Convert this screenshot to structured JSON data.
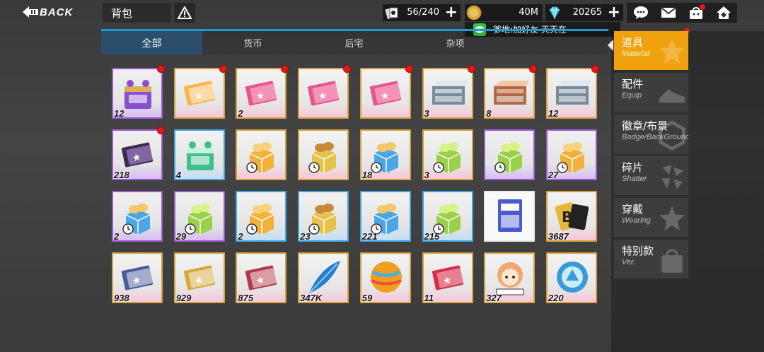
{
  "header": {
    "back_label": "BACK",
    "title": "背包",
    "help_icon": "warning-triangle-icon",
    "resources": [
      {
        "name": "capacity",
        "icon": "cards-icon",
        "value": "56/240",
        "has_plus": true
      },
      {
        "name": "gold",
        "icon": "coin-icon",
        "value": "40M",
        "has_plus": false
      },
      {
        "name": "diamond",
        "icon": "diamond-icon",
        "value": "20265",
        "has_plus": true
      }
    ],
    "plus_label": "+",
    "icons": [
      "chat-bubble-icon",
      "mail-icon",
      "shop-bag-icon",
      "home-icon"
    ]
  },
  "chat": {
    "text": "爹地:加好友 天天在",
    "icon": "wechat-icon",
    "accent": "#2ecc40"
  },
  "tabs": [
    {
      "label": "全部",
      "active": true
    },
    {
      "label": "货币",
      "active": false
    },
    {
      "label": "后宅",
      "active": false
    },
    {
      "label": "杂项",
      "active": false
    }
  ],
  "colors": {
    "accent_blue": "#1e9ad4",
    "tab_active": "#2b4e6b",
    "side_active": "#f0a20e",
    "rarity_gold": "#d2a23b",
    "rarity_purple": "#9c59d1",
    "rarity_blue": "#3fa6e3",
    "badge_red": "#e01a1a"
  },
  "items": [
    {
      "count": "12",
      "rarity": "purple",
      "icon": "purple-gift-box-icon",
      "new": true
    },
    {
      "count": "",
      "rarity": "gold",
      "icon": "orange-ticket-box-icon",
      "new": true
    },
    {
      "count": "2",
      "rarity": "gold",
      "icon": "pink-ticket-icon",
      "new": true
    },
    {
      "count": "",
      "rarity": "gold",
      "icon": "pink-ticket-icon",
      "new": true
    },
    {
      "count": "",
      "rarity": "gold",
      "icon": "pink-ticket-icon",
      "new": true
    },
    {
      "count": "3",
      "rarity": "gold",
      "icon": "grey-card-box-icon",
      "new": true
    },
    {
      "count": "8",
      "rarity": "gold",
      "icon": "brown-card-box-icon",
      "new": true
    },
    {
      "count": "12",
      "rarity": "gold",
      "icon": "grey-card-box-icon",
      "new": true
    },
    {
      "count": "218",
      "rarity": "purple",
      "icon": "black-ticket-icon",
      "new": true
    },
    {
      "count": "4",
      "rarity": "blue",
      "icon": "green-box-icon",
      "new": false
    },
    {
      "count": "",
      "rarity": "gold",
      "icon": "orange-open-box-icon",
      "new": false
    },
    {
      "count": "",
      "rarity": "gold",
      "icon": "yellow-open-box-icon",
      "new": false
    },
    {
      "count": "18",
      "rarity": "gold",
      "icon": "blue-open-box-icon",
      "new": false
    },
    {
      "count": "3",
      "rarity": "gold",
      "icon": "green-open-box-icon",
      "new": false
    },
    {
      "count": "",
      "rarity": "purple",
      "icon": "green-open-box-icon",
      "new": false
    },
    {
      "count": "27",
      "rarity": "purple",
      "icon": "orange-open-box-icon",
      "new": false
    },
    {
      "count": "2",
      "rarity": "purple",
      "icon": "blue-open-box-icon",
      "new": false
    },
    {
      "count": "29",
      "rarity": "purple",
      "icon": "green-open-box-icon",
      "new": false
    },
    {
      "count": "2",
      "rarity": "blue",
      "icon": "orange-open-box-icon",
      "new": false
    },
    {
      "count": "23",
      "rarity": "blue",
      "icon": "yellow-open-box-icon",
      "new": false
    },
    {
      "count": "221",
      "rarity": "blue",
      "icon": "blue-open-box-icon",
      "new": false
    },
    {
      "count": "215",
      "rarity": "blue",
      "icon": "green-open-box-icon",
      "new": false
    },
    {
      "count": "",
      "rarity": "white",
      "icon": "blue-card-icon",
      "new": false
    },
    {
      "count": "3687",
      "rarity": "gold",
      "icon": "bt-token-icon",
      "new": false
    },
    {
      "count": "938",
      "rarity": "gold",
      "icon": "blue-voucher-icon",
      "new": false
    },
    {
      "count": "929",
      "rarity": "gold",
      "icon": "gold-voucher-icon",
      "new": false
    },
    {
      "count": "875",
      "rarity": "gold",
      "icon": "red-voucher-icon",
      "new": false
    },
    {
      "count": "347K",
      "rarity": "gold",
      "icon": "feather-icon",
      "new": false
    },
    {
      "count": "59",
      "rarity": "gold",
      "icon": "striped-ball-icon",
      "new": false
    },
    {
      "count": "11",
      "rarity": "gold",
      "icon": "red-ticket-icon",
      "new": false
    },
    {
      "count": "327",
      "rarity": "gold",
      "icon": "chibi-girl-icon",
      "new": false
    },
    {
      "count": "220",
      "rarity": "gold",
      "icon": "blue-emblem-icon",
      "new": false
    }
  ],
  "sidebar": [
    {
      "cn": "道具",
      "en": "Material",
      "active": true,
      "icon": "star-icon"
    },
    {
      "cn": "配件",
      "en": "Equip",
      "active": false,
      "icon": "shoe-icon"
    },
    {
      "cn": "徽章/布景",
      "en": "Badge/BackGround",
      "active": false,
      "icon": "hexagon-icon"
    },
    {
      "cn": "碎片",
      "en": "Shatter",
      "active": false,
      "icon": "shards-icon"
    },
    {
      "cn": "穿戴",
      "en": "Wearing",
      "active": false,
      "icon": "star-icon"
    },
    {
      "cn": "特别款",
      "en": "Ver.",
      "active": false,
      "icon": "bag-icon"
    }
  ]
}
